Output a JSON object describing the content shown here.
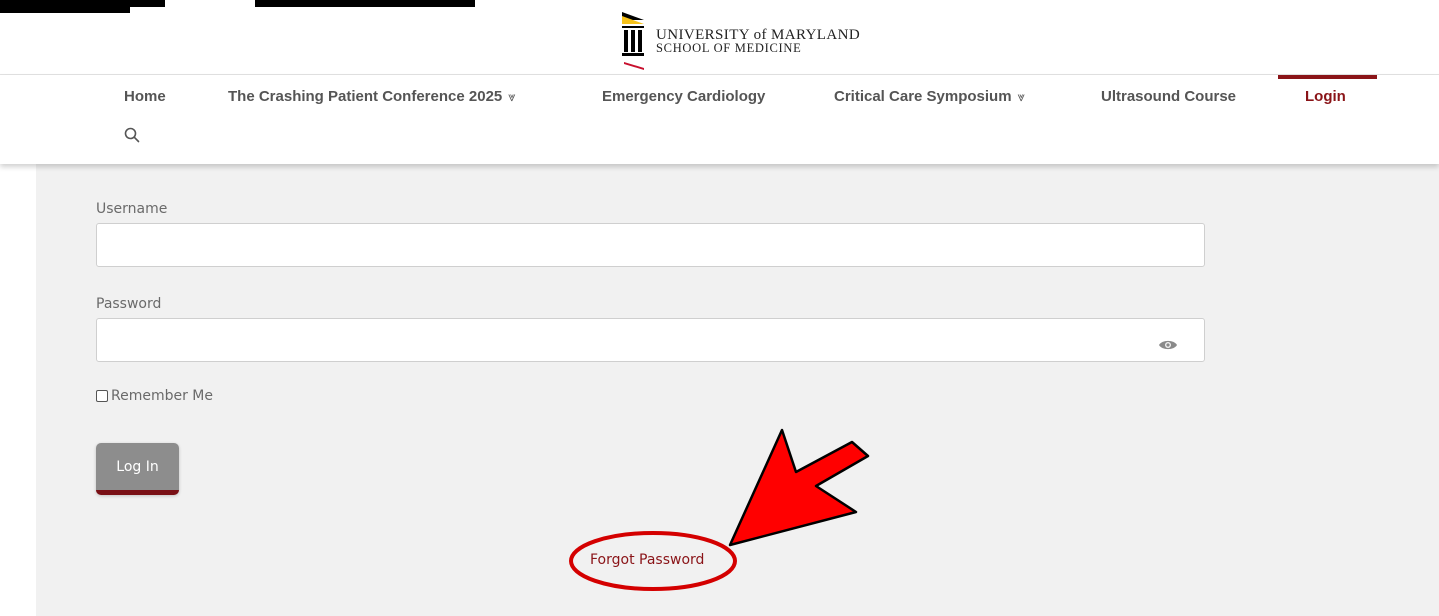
{
  "brand": {
    "line1": "UNIVERSITY of MARYLAND",
    "line2": "SCHOOL OF MEDICINE",
    "colors": {
      "black": "#000000",
      "gold": "#f6c21a",
      "red": "#c8102e"
    }
  },
  "nav": {
    "items": [
      {
        "label": "Home"
      },
      {
        "label": "The Crashing Patient Conference 2025",
        "chevron": "⩔"
      },
      {
        "label": "Emergency Cardiology"
      },
      {
        "label": "Critical Care Symposium",
        "chevron": "⩔"
      },
      {
        "label": "Ultrasound Course"
      },
      {
        "label": "Login",
        "active": true
      }
    ],
    "search_icon": "search-icon",
    "accent": "#8a1418"
  },
  "form": {
    "username_label": "Username",
    "username_value": "",
    "password_label": "Password",
    "password_value": "",
    "password_toggle_icon": "eye-icon",
    "remember_label": "Remember Me",
    "remember_checked": false,
    "login_button": "Log In",
    "forgot_link": "Forgot Password"
  },
  "annotation": {
    "color": "#e20000",
    "shapes": [
      "red-arrow",
      "red-ellipse"
    ]
  }
}
